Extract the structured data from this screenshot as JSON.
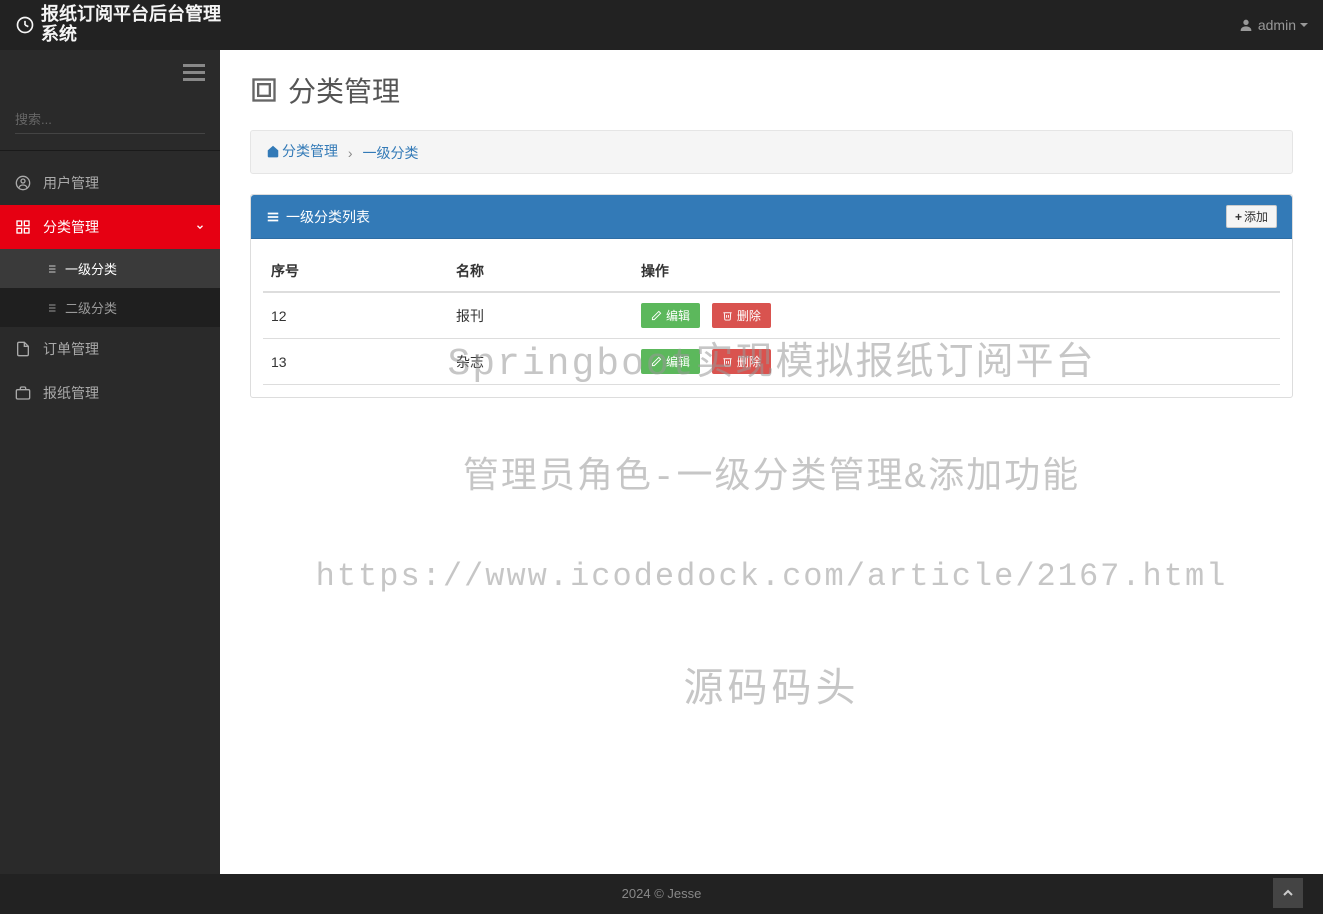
{
  "app": {
    "title": "报纸订阅平台后台管理系统"
  },
  "user": {
    "name": "admin"
  },
  "sidebar": {
    "search_placeholder": "搜索...",
    "items": [
      {
        "label": "用户管理"
      },
      {
        "label": "分类管理"
      },
      {
        "label": "订单管理"
      },
      {
        "label": "报纸管理"
      }
    ],
    "submenu": [
      {
        "label": "一级分类"
      },
      {
        "label": "二级分类"
      }
    ]
  },
  "page": {
    "title": "分类管理"
  },
  "breadcrumb": {
    "root": "分类管理",
    "current": "一级分类"
  },
  "panel": {
    "title": "一级分类列表",
    "add_label": "添加",
    "columns": {
      "serial": "序号",
      "name": "名称",
      "action": "操作"
    },
    "edit_label": "编辑",
    "delete_label": "删除",
    "rows": [
      {
        "id": "12",
        "name": "报刊"
      },
      {
        "id": "13",
        "name": "杂志"
      }
    ]
  },
  "watermark": {
    "line1": "Springboot实现模拟报纸订阅平台",
    "line2": "管理员角色-一级分类管理&添加功能",
    "line3": "https://www.icodedock.com/article/2167.html",
    "line4": "源码码头"
  },
  "footer": {
    "text": "2024 © Jesse"
  }
}
